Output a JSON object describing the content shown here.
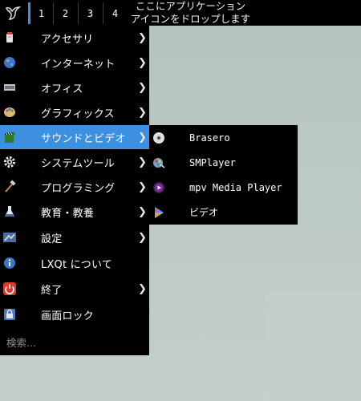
{
  "panel": {
    "workspaces": [
      "1",
      "2",
      "3",
      "4"
    ],
    "active_workspace": "1",
    "quicklaunch_hint_line1": "ここにアプリケーション",
    "quicklaunch_hint_line2": "アイコンをドロップします"
  },
  "menu": {
    "items": [
      {
        "label": "アクセサリ",
        "icon": "accessories-icon",
        "submenu": true
      },
      {
        "label": "インターネット",
        "icon": "internet-globe-icon",
        "submenu": true
      },
      {
        "label": "オフィス",
        "icon": "office-icon",
        "submenu": true
      },
      {
        "label": "グラフィックス",
        "icon": "graphics-palette-icon",
        "submenu": true
      },
      {
        "label": "サウンドとビデオ",
        "icon": "sound-video-icon",
        "submenu": true,
        "active": true
      },
      {
        "label": "システムツール",
        "icon": "gear-icon",
        "submenu": true
      },
      {
        "label": "プログラミング",
        "icon": "hammer-icon",
        "submenu": true
      },
      {
        "label": "教育・教養",
        "icon": "flask-icon",
        "submenu": true
      },
      {
        "label": "設定",
        "icon": "settings-icon",
        "submenu": true
      },
      {
        "label": "LXQt について",
        "icon": "info-icon",
        "submenu": false
      },
      {
        "label": "終了",
        "icon": "power-icon",
        "submenu": true
      },
      {
        "label": "画面ロック",
        "icon": "lock-screen-icon",
        "submenu": false
      }
    ],
    "arrow": "❯",
    "search_placeholder": "検索..."
  },
  "submenu": {
    "items": [
      {
        "label": "Brasero",
        "icon": "disc-icon"
      },
      {
        "label": "SMPlayer",
        "icon": "smplayer-icon"
      },
      {
        "label": "mpv Media Player",
        "icon": "mpv-icon"
      },
      {
        "label": "ビデオ",
        "icon": "video-play-icon"
      }
    ]
  },
  "colors": {
    "highlight": "#3d8fe0",
    "menu_bg": "#000000",
    "desktop": "#b9c5c1"
  }
}
